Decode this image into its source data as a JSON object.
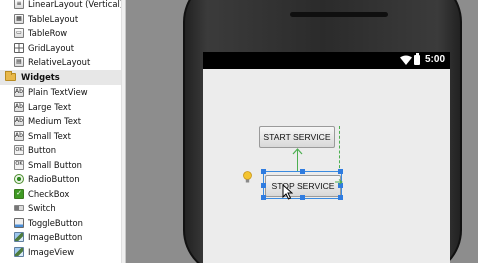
{
  "palette": {
    "layouts": [
      {
        "label": "LinearLayout (Vertical)",
        "icon": "linear-layout-icon"
      },
      {
        "label": "TableLayout",
        "icon": "table-layout-icon"
      },
      {
        "label": "TableRow",
        "icon": "table-row-icon"
      },
      {
        "label": "GridLayout",
        "icon": "grid-layout-icon"
      },
      {
        "label": "RelativeLayout",
        "icon": "relative-layout-icon"
      }
    ],
    "widgets_header": "Widgets",
    "widgets": [
      {
        "label": "Plain TextView",
        "icon": "Ab"
      },
      {
        "label": "Large Text",
        "icon": "Ab"
      },
      {
        "label": "Medium Text",
        "icon": "Ab"
      },
      {
        "label": "Small Text",
        "icon": "Ab"
      },
      {
        "label": "Button",
        "icon": "OK"
      },
      {
        "label": "Small Button",
        "icon": "OK"
      },
      {
        "label": "RadioButton",
        "icon": "radio-icon"
      },
      {
        "label": "CheckBox",
        "icon": "checkbox-icon"
      },
      {
        "label": "Switch",
        "icon": "switch-icon"
      },
      {
        "label": "ToggleButton",
        "icon": "toggle-icon"
      },
      {
        "label": "ImageButton",
        "icon": "image-button-icon"
      },
      {
        "label": "ImageView",
        "icon": "image-view-icon"
      }
    ]
  },
  "device": {
    "clock": "5:00"
  },
  "layout_preview": {
    "start_button": "START SERVICE",
    "stop_button": "STOP SERVICE"
  },
  "colors": {
    "selection": "#3b8be0",
    "constraint": "#4caf50",
    "folder": "#e8b84a"
  }
}
